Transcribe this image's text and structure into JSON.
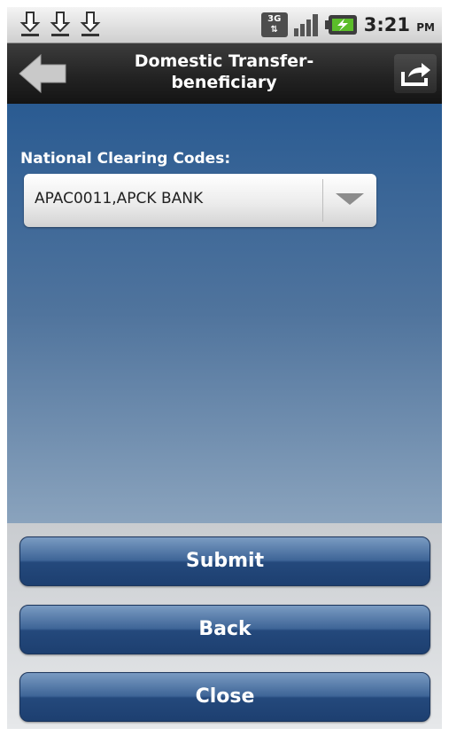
{
  "status_bar": {
    "download_icons": [
      "download-icon",
      "download-icon",
      "download-icon"
    ],
    "network_label": "3G",
    "time": "3:21",
    "ampm": "PM"
  },
  "title_bar": {
    "title_line1": "Domestic Transfer-",
    "title_line2": "beneficiary"
  },
  "form": {
    "clearing_label": "National Clearing Codes:",
    "clearing_value": "APAC0011,APCK BANK"
  },
  "buttons": {
    "submit": "Submit",
    "back": "Back",
    "close": "Close"
  }
}
